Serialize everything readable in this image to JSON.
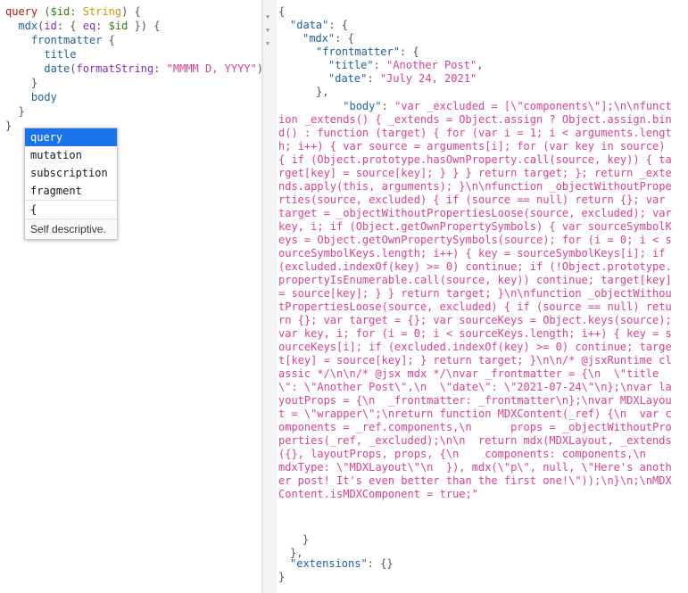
{
  "query_lines": [
    {
      "parts": [
        [
          "kw",
          "query"
        ],
        [
          "punc",
          " ("
        ],
        [
          "var",
          "$id"
        ],
        [
          "punc",
          ": "
        ],
        [
          "type",
          "String"
        ],
        [
          "punc",
          ") {"
        ]
      ]
    },
    {
      "parts": [
        [
          "plain",
          "  mdx"
        ],
        [
          "punc",
          "("
        ],
        [
          "arg",
          "id"
        ],
        [
          "punc",
          ": { "
        ],
        [
          "arg",
          "eq"
        ],
        [
          "punc",
          ": "
        ],
        [
          "var",
          "$id"
        ],
        [
          "punc",
          " }) {"
        ]
      ]
    },
    {
      "parts": [
        [
          "plain",
          "    frontmatter"
        ],
        [
          "punc",
          " {"
        ]
      ]
    },
    {
      "parts": [
        [
          "plain",
          "      title"
        ]
      ]
    },
    {
      "parts": [
        [
          "plain",
          "      date"
        ],
        [
          "punc",
          "("
        ],
        [
          "arg",
          "formatString"
        ],
        [
          "punc",
          ": "
        ],
        [
          "str",
          "\"MMMM D, YYYY\""
        ],
        [
          "punc",
          ")"
        ]
      ]
    },
    {
      "parts": [
        [
          "punc",
          "    }"
        ]
      ]
    },
    {
      "parts": [
        [
          "plain",
          "    body"
        ]
      ]
    },
    {
      "parts": [
        [
          "punc",
          "  }"
        ]
      ]
    },
    {
      "parts": [
        [
          "punc",
          "}"
        ]
      ]
    }
  ],
  "autocomplete": {
    "items": [
      "query",
      "mutation",
      "subscription",
      "fragment",
      "{"
    ],
    "selected": "query",
    "description": "Self descriptive."
  },
  "result": {
    "open_brace": "{",
    "data_key": "\"data\"",
    "mdx_key": "\"mdx\"",
    "frontmatter_key": "\"frontmatter\"",
    "title_key": "\"title\"",
    "title_value": "\"Another Post\"",
    "date_key": "\"date\"",
    "date_value": "\"July 24, 2021\"",
    "body_key": "\"body\"",
    "body_value": "\"var _excluded = [\\\"components\\\"];\\n\\nfunction _extends() { _extends = Object.assign ? Object.assign.bind() : function (target) { for (var i = 1; i < arguments.length; i++) { var source = arguments[i]; for (var key in source) { if (Object.prototype.hasOwnProperty.call(source, key)) { target[key] = source[key]; } } } return target; }; return _extends.apply(this, arguments); }\\n\\nfunction _objectWithoutProperties(source, excluded) { if (source == null) return {}; var target = _objectWithoutPropertiesLoose(source, excluded); var key, i; if (Object.getOwnPropertySymbols) { var sourceSymbolKeys = Object.getOwnPropertySymbols(source); for (i = 0; i < sourceSymbolKeys.length; i++) { key = sourceSymbolKeys[i]; if (excluded.indexOf(key) >= 0) continue; if (!Object.prototype.propertyIsEnumerable.call(source, key)) continue; target[key] = source[key]; } } return target; }\\n\\nfunction _objectWithoutPropertiesLoose(source, excluded) { if (source == null) return {}; var target = {}; var sourceKeys = Object.keys(source); var key, i; for (i = 0; i < sourceKeys.length; i++) { key = sourceKeys[i]; if (excluded.indexOf(key) >= 0) continue; target[key] = source[key]; } return target; }\\n\\n/* @jsxRuntime classic */\\n\\n/* @jsx mdx */\\nvar _frontmatter = {\\n  \\\"title\\\": \\\"Another Post\\\",\\n  \\\"date\\\": \\\"2021-07-24\\\"\\n};\\nvar layoutProps = {\\n  _frontmatter: _frontmatter\\n};\\nvar MDXLayout = \\\"wrapper\\\";\\nreturn function MDXContent(_ref) {\\n  var components = _ref.components,\\n      props = _objectWithoutProperties(_ref, _excluded);\\n\\n  return mdx(MDXLayout, _extends({}, layoutProps, props, {\\n    components: components,\\n    mdxType: \\\"MDXLayout\\\"\\n  }), mdx(\\\"p\\\", null, \\\"Here's another post! It's even better than the first one!\\\"));\\n}\\n;\\nMDXContent.isMDXComponent = true;\"",
    "extensions_key": "\"extensions\"",
    "extensions_value": "{}",
    "close_brace": "}"
  }
}
